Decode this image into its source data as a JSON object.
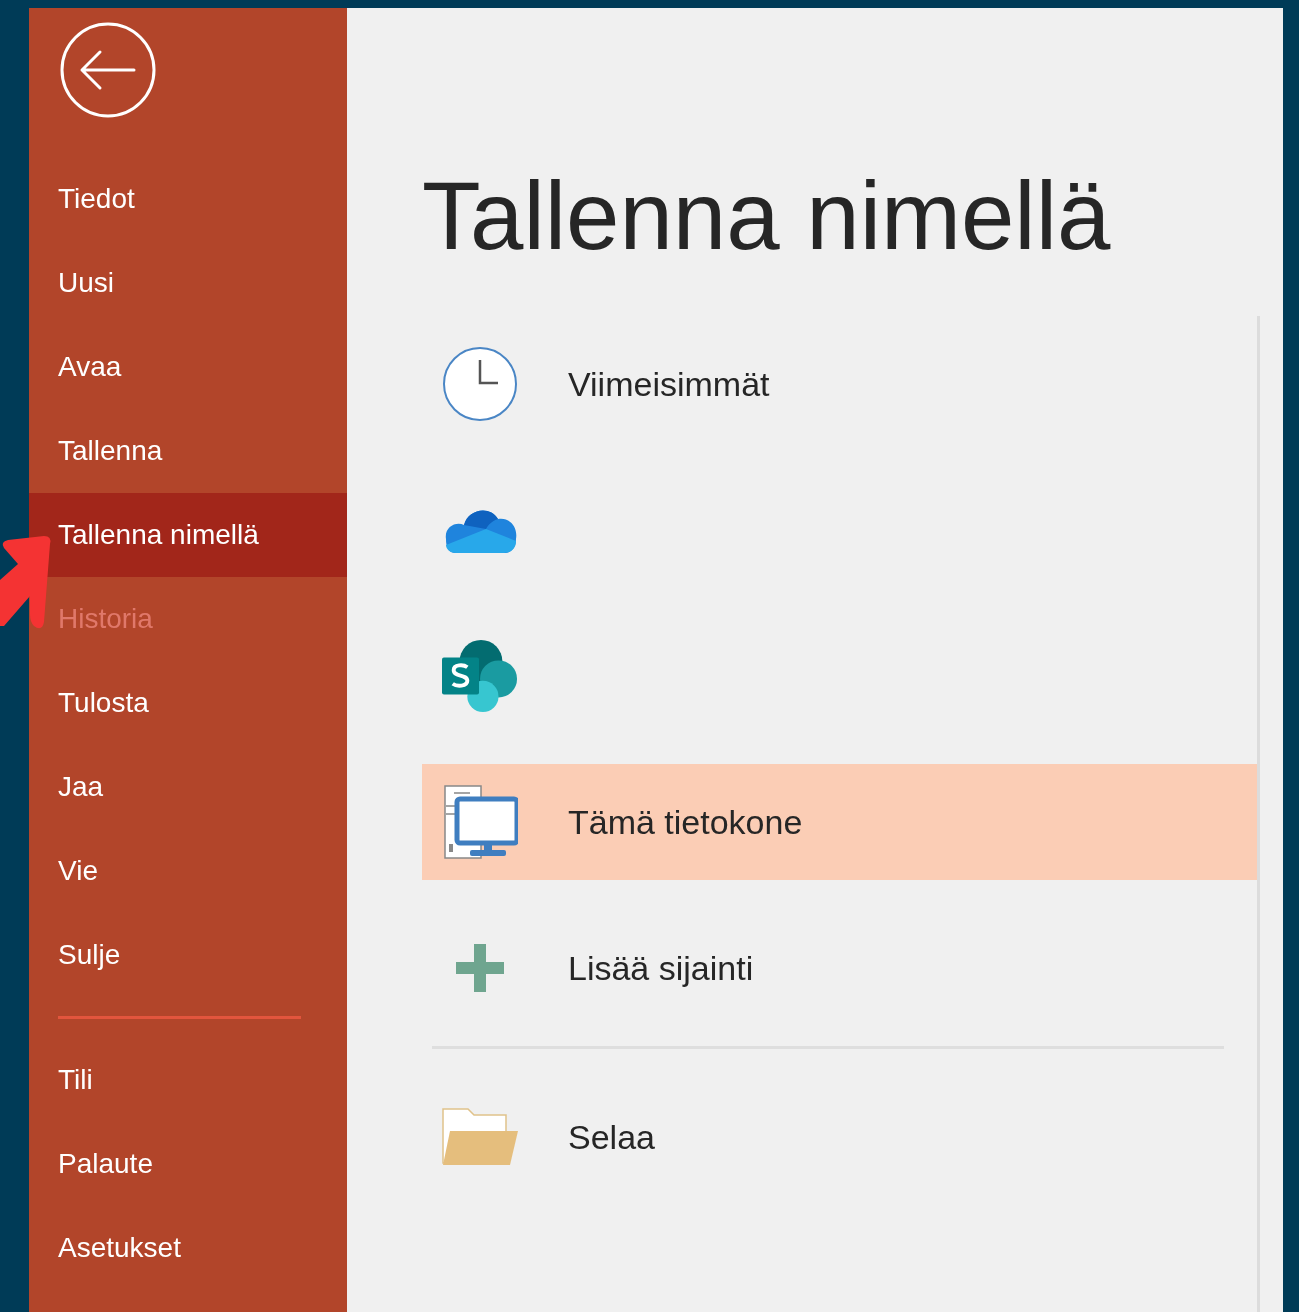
{
  "sidebar": {
    "items": [
      {
        "label": "Tiedot",
        "selected": false,
        "disabled": false
      },
      {
        "label": "Uusi",
        "selected": false,
        "disabled": false
      },
      {
        "label": "Avaa",
        "selected": false,
        "disabled": false
      },
      {
        "label": "Tallenna",
        "selected": false,
        "disabled": false
      },
      {
        "label": "Tallenna nimellä",
        "selected": true,
        "disabled": false
      },
      {
        "label": "Historia",
        "selected": false,
        "disabled": true
      },
      {
        "label": "Tulosta",
        "selected": false,
        "disabled": false
      },
      {
        "label": "Jaa",
        "selected": false,
        "disabled": false
      },
      {
        "label": "Vie",
        "selected": false,
        "disabled": false
      },
      {
        "label": "Sulje",
        "selected": false,
        "disabled": false
      }
    ],
    "footer_items": [
      {
        "label": "Tili"
      },
      {
        "label": "Palaute"
      },
      {
        "label": "Asetukset"
      }
    ]
  },
  "page": {
    "title": "Tallenna nimellä",
    "locations": [
      {
        "kind": "recent",
        "label": "Viimeisimmät",
        "selected": false
      },
      {
        "kind": "onedrive",
        "selected": false
      },
      {
        "kind": "sharepoint",
        "selected": false
      },
      {
        "kind": "computer",
        "label": "Tämä tietokone",
        "selected": true
      },
      {
        "kind": "add",
        "label": "Lisää sijainti",
        "selected": false
      }
    ],
    "browse": {
      "label": "Selaa"
    }
  }
}
